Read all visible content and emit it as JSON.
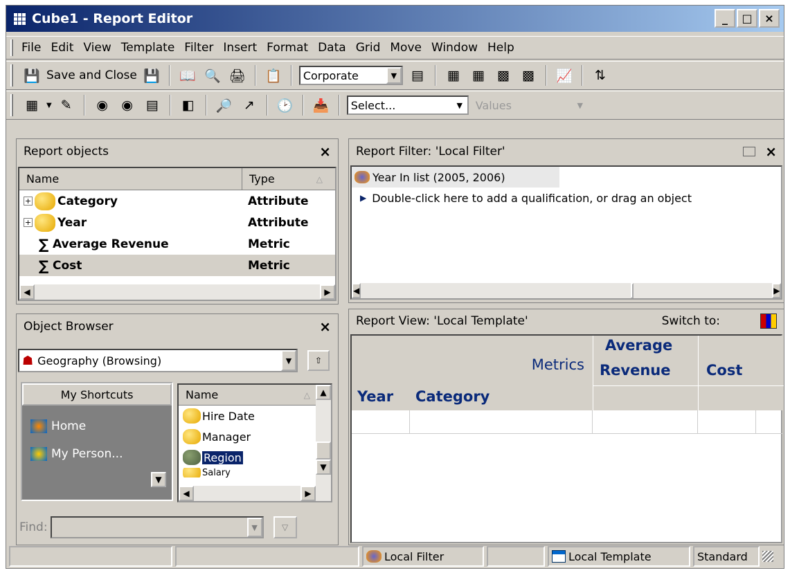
{
  "window": {
    "title": "Cube1 - Report Editor",
    "controls": [
      "_",
      "□",
      "×"
    ]
  },
  "menu": [
    "File",
    "Edit",
    "View",
    "Template",
    "Filter",
    "Insert",
    "Format",
    "Data",
    "Grid",
    "Move",
    "Window",
    "Help"
  ],
  "toolbar1": {
    "save_close_label": "Save and Close",
    "style_combo": "Corporate"
  },
  "toolbar2": {
    "select_combo": "Select...",
    "values_combo": "Values"
  },
  "report_objects": {
    "title": "Report objects",
    "col_name": "Name",
    "col_type": "Type",
    "rows": [
      {
        "name": "Category",
        "type": "Attribute"
      },
      {
        "name": "Year",
        "type": "Attribute"
      },
      {
        "name": "Average Revenue",
        "type": "Metric"
      },
      {
        "name": "Cost",
        "type": "Metric"
      }
    ]
  },
  "report_filter": {
    "title": "Report Filter: 'Local Filter'",
    "condition": "Year In list (2005, 2006)",
    "hint": "Double-click here to add a qualification, or drag an object"
  },
  "object_browser": {
    "title": "Object Browser",
    "location": "Geography (Browsing)",
    "shortcuts_title": "My Shortcuts",
    "shortcuts": [
      "Home",
      "My Person..."
    ],
    "list_header": "Name",
    "items": [
      "Hire Date",
      "Manager",
      "Region",
      "Salary"
    ],
    "find_label": "Find:"
  },
  "report_view": {
    "title": "Report View: 'Local Template'",
    "switch_label": "Switch to:",
    "metrics_label": "Metrics",
    "col_avg_revenue_1": "Average",
    "col_avg_revenue_2": "Revenue",
    "col_cost": "Cost",
    "row_year": "Year",
    "row_category": "Category"
  },
  "status": {
    "local_filter": "Local Filter",
    "local_template": "Local Template",
    "mode": "Standard"
  },
  "colors": {
    "title_bar": "#0a246a",
    "template_text": "#0a2a7a",
    "shortcuts_bg": "#808080"
  }
}
